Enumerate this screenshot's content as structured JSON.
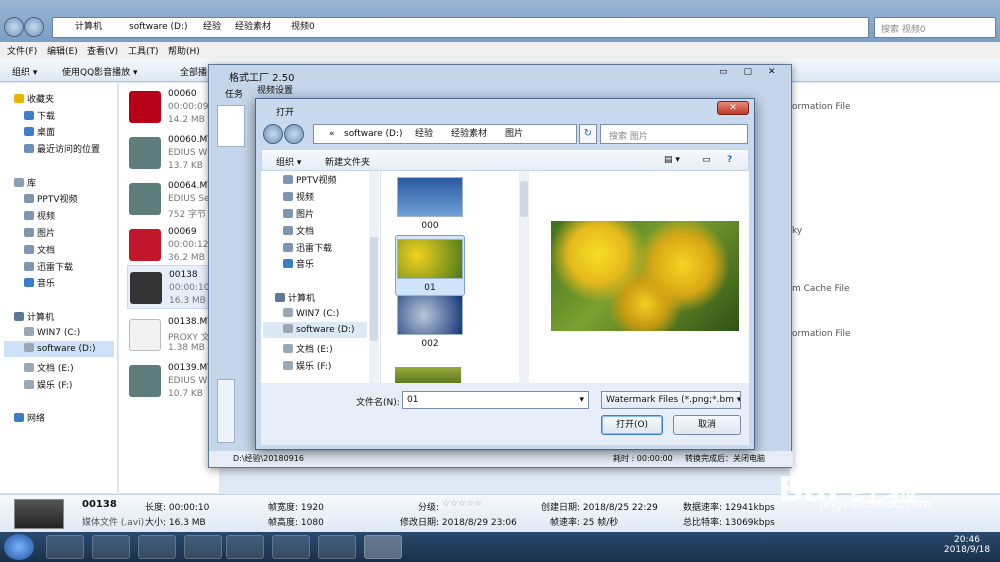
{
  "explorer": {
    "breadcrumb": [
      "计算机",
      "software (D:)",
      "经验",
      "经验素材",
      "视频0"
    ],
    "search_placeholder": "搜索 视频0",
    "menu": [
      "文件(F)",
      "编辑(E)",
      "查看(V)",
      "工具(T)",
      "帮助(H)"
    ],
    "toolbar": {
      "organize": "组织 ▾",
      "qq_play": "使用QQ影音播放 ▾",
      "play_all": "全部播"
    },
    "nav": {
      "favorites": "收藏夹",
      "fav_items": [
        "下载",
        "桌面",
        "最近访问的位置"
      ],
      "library": "库",
      "lib_items": [
        "PPTV视频",
        "视频",
        "图片",
        "文档",
        "迅雷下载",
        "音乐"
      ],
      "computer": "计算机",
      "drives": [
        "WIN7 (C:)",
        "software (D:)",
        "文档 (E:)",
        "娱乐 (F:)"
      ],
      "network": "网络"
    },
    "files": [
      {
        "name": "00060",
        "sub1": "00:00:09",
        "sub2": "14.2 MB"
      },
      {
        "name": "00060.MT",
        "sub1": "EDIUS W",
        "sub2": "13.7 KB"
      },
      {
        "name": "00064.MT",
        "sub1": "EDIUS Se",
        "sub2": "752 字节"
      },
      {
        "name": "00069",
        "sub1": "00:00:12",
        "sub2": "36.2 MB"
      },
      {
        "name": "00138",
        "sub1": "00:00:10",
        "sub2": "16.3 MB"
      },
      {
        "name": "00138.MT",
        "sub1": "PROXY 文",
        "sub2": "1.38 MB"
      },
      {
        "name": "00139.MT",
        "sub1": "EDIUS W",
        "sub2": "10.7 KB"
      }
    ],
    "right_pane": [
      "ormation File",
      "ky",
      "m Cache File",
      "ormation File"
    ],
    "status": {
      "name": "00138",
      "type": "媒体文件 (.avi)",
      "length": "长度: 00:00:10",
      "size": "大小: 16.3 MB",
      "width": "帧宽度: 1920",
      "height": "帧高度: 1080",
      "rating": "分级:",
      "modified": "修改日期: 2018/8/29 23:06",
      "created": "创建日期: 2018/8/25 22:29",
      "framerate": "帧速率: 25 帧/秒",
      "datarate": "数据速率: 12941kbps",
      "bitrate": "总比特率: 13069kbps"
    }
  },
  "format_factory": {
    "title": "格式工厂 2.50",
    "task_tab": "任务",
    "video_settings": "视频设置",
    "status_left": "D:\\经验\\20180916",
    "status_mid": "耗时 : 00:00:00",
    "status_right": "转换完成后：关闭电脑"
  },
  "open_dialog": {
    "title": "打开",
    "path": [
      "«",
      "software (D:)",
      "经验",
      "经验素材",
      "图片"
    ],
    "search_placeholder": "搜索 图片",
    "toolbar": {
      "organize": "组织 ▾",
      "new_folder": "新建文件夹"
    },
    "tree": [
      "PPTV视频",
      "视频",
      "图片",
      "文档",
      "迅雷下载",
      "音乐",
      "计算机",
      "WIN7 (C:)",
      "software (D:)",
      "文档 (E:)",
      "娱乐 (F:)"
    ],
    "items": [
      {
        "label": "000",
        "color": "#3b6fb5"
      },
      {
        "label": "01",
        "color": "#c8a41b"
      },
      {
        "label": "002",
        "color": "#1f4fa0"
      }
    ],
    "filename_label": "文件名(N):",
    "filename_value": "01",
    "filetype": "Watermark Files (*.png;*.bm ▾",
    "open_button": "打开(O)",
    "cancel_button": "取消"
  },
  "taskbar": {
    "time": "20:46",
    "date": "2018/9/18"
  },
  "watermark": {
    "logo": "Bai 经验",
    "url": "jingyan.baidu.com"
  }
}
